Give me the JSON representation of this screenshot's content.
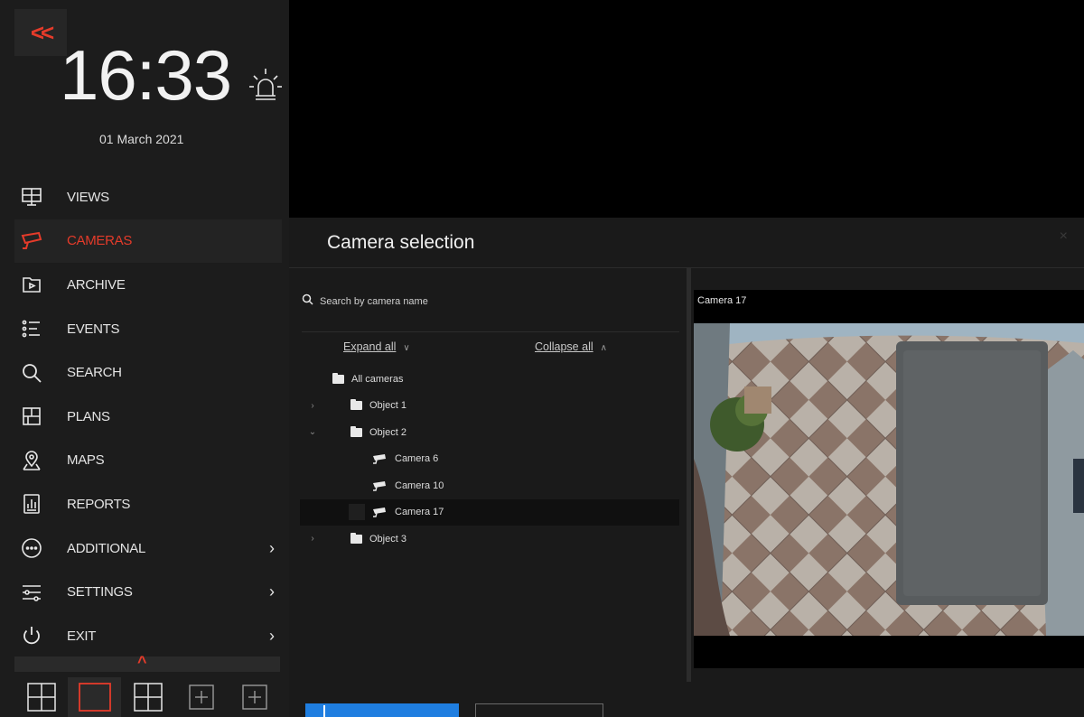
{
  "sidebar": {
    "collapse_label": "<<",
    "clock": "16:33",
    "date": "01 March 2021",
    "nav": [
      {
        "label": "VIEWS",
        "icon": "views-icon"
      },
      {
        "label": "CAMERAS",
        "icon": "camera-icon"
      },
      {
        "label": "ARCHIVE",
        "icon": "archive-icon"
      },
      {
        "label": "EVENTS",
        "icon": "events-icon"
      },
      {
        "label": "SEARCH",
        "icon": "search-icon"
      },
      {
        "label": "PLANS",
        "icon": "plans-icon"
      },
      {
        "label": "MAPS",
        "icon": "maps-icon"
      },
      {
        "label": "REPORTS",
        "icon": "reports-icon"
      },
      {
        "label": "ADDITIONAL",
        "icon": "more-icon"
      },
      {
        "label": "SETTINGS",
        "icon": "settings-icon"
      },
      {
        "label": "EXIT",
        "icon": "power-icon"
      }
    ],
    "active_item": "CAMERAS",
    "accent_color": "#e53b2a"
  },
  "dialog": {
    "title": "Camera selection",
    "close": "×",
    "search_placeholder": "Search by camera name",
    "expand_all": "Expand all",
    "collapse_all": "Collapse all",
    "tree": [
      {
        "label": "All cameras",
        "type": "folder"
      },
      {
        "label": "Object 1",
        "type": "folder",
        "toggle": "›"
      },
      {
        "label": "Object 2",
        "type": "folder",
        "toggle": "⌄"
      },
      {
        "label": "Camera 6",
        "type": "camera"
      },
      {
        "label": "Camera 10",
        "type": "camera"
      },
      {
        "label": "Camera 17",
        "type": "camera",
        "selected": true
      },
      {
        "label": "Object 3",
        "type": "folder",
        "toggle": "›"
      }
    ],
    "preview_title": "Camera 17",
    "primary_color": "#1f7ee0"
  }
}
